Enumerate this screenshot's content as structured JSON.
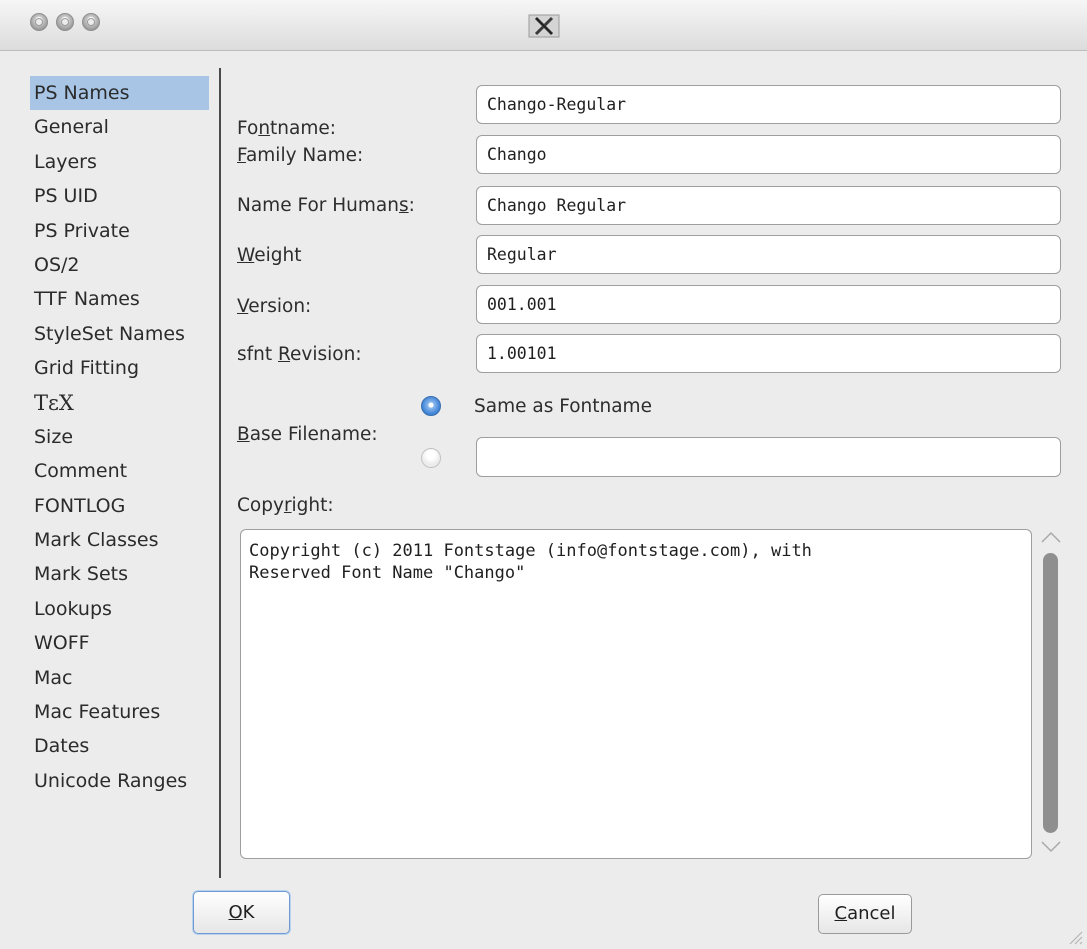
{
  "window": {
    "title_icon": "x-window-icon",
    "controls": [
      "close",
      "minimize",
      "maximize"
    ]
  },
  "sidebar": {
    "items": [
      {
        "label": "PS Names",
        "selected": true
      },
      {
        "label": "General"
      },
      {
        "label": "Layers"
      },
      {
        "label": "PS UID"
      },
      {
        "label": "PS Private"
      },
      {
        "label": "OS/2"
      },
      {
        "label": "TTF Names"
      },
      {
        "label": "StyleSet Names"
      },
      {
        "label": "Grid Fitting"
      },
      {
        "label": "TεX"
      },
      {
        "label": "Size"
      },
      {
        "label": "Comment"
      },
      {
        "label": "FONTLOG"
      },
      {
        "label": "Mark Classes"
      },
      {
        "label": "Mark Sets"
      },
      {
        "label": "Lookups"
      },
      {
        "label": "WOFF"
      },
      {
        "label": "Mac"
      },
      {
        "label": "Mac Features"
      },
      {
        "label": "Dates"
      },
      {
        "label": "Unicode Ranges"
      }
    ]
  },
  "form": {
    "fontname": {
      "label_pre": "Fo",
      "label_mn": "n",
      "label_post": "tname:",
      "value": "Chango-Regular"
    },
    "family": {
      "label_pre": "",
      "label_mn": "F",
      "label_post": "amily Name:",
      "value": "Chango"
    },
    "humans": {
      "label_pre": "Name For Human",
      "label_mn": "s",
      "label_post": ":",
      "value": "Chango Regular"
    },
    "weight": {
      "label_pre": "",
      "label_mn": "W",
      "label_post": "eight",
      "value": "Regular"
    },
    "version": {
      "label_pre": "",
      "label_mn": "V",
      "label_post": "ersion:",
      "value": "001.001"
    },
    "sfnt": {
      "label_pre": "sfnt ",
      "label_mn": "R",
      "label_post": "evision:",
      "value": "1.00101"
    },
    "base_filename": {
      "label_pre": "",
      "label_mn": "B",
      "label_post": "ase Filename:",
      "option_same": "Same as Fontname",
      "selected": "same",
      "custom_value": ""
    },
    "copyright": {
      "label_pre": "Copy",
      "label_mn": "r",
      "label_post": "ight:",
      "value": "Copyright (c) 2011 Fontstage (info@fontstage.com), with\nReserved Font Name \"Chango\""
    }
  },
  "buttons": {
    "ok": {
      "mn": "O",
      "rest": "K"
    },
    "cancel": {
      "mn": "C",
      "rest": "ancel"
    }
  },
  "colors": {
    "selection": "#a8c5e6",
    "window_bg": "#ececec",
    "radio_selected": "#3d82d6"
  }
}
